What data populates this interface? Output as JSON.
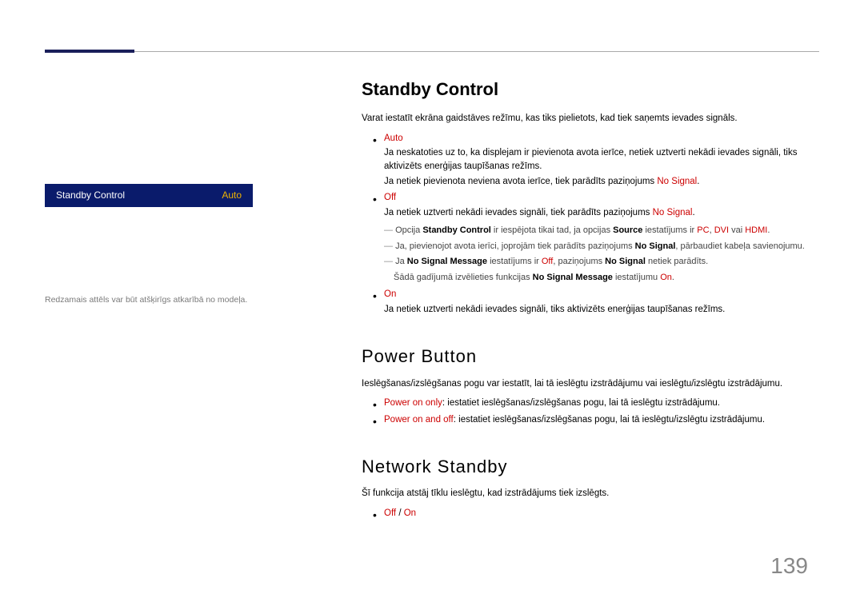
{
  "sidebar": {
    "menu_label": "Standby Control",
    "menu_value": "Auto",
    "note": "Redzamais attēls var būt atšķirīgs atkarībā no modeļa."
  },
  "section1": {
    "title": "Standby Control",
    "intro": "Varat iestatīt ekrāna gaidstāves režīmu, kas tiks pielietots, kad tiek saņemts ievades signāls.",
    "items": {
      "auto": {
        "title": "Auto",
        "l1": "Ja neskatoties uz to, ka displejam ir pievienota avota ierīce, netiek uztverti nekādi ievades signāli, tiks aktivizēts enerģijas taupīšanas režīms.",
        "l2_pre": "Ja netiek pievienota neviena avota ierīce, tiek parādīts paziņojums ",
        "l2_red": "No Signal",
        "l2_post": "."
      },
      "off": {
        "title": "Off",
        "l_pre": "Ja netiek uztverti nekādi ievades signāli, tiek parādīts paziņojums ",
        "l_red": "No Signal",
        "l_post": "."
      },
      "on": {
        "title": "On",
        "l": "Ja netiek uztverti nekādi ievades signāli, tiks aktivizēts enerģijas taupīšanas režīms."
      }
    },
    "notes": {
      "n1": {
        "pre": "Opcija ",
        "b1": "Standby Control",
        "mid1": " ir iespējota tikai tad, ja opcijas ",
        "b2": "Source",
        "mid2": " iestatījums ir ",
        "r1": "PC",
        "c1": ", ",
        "r2": "DVI",
        "c2": " vai ",
        "r3": "HDMI",
        "post": "."
      },
      "n2": {
        "pre": "Ja, pievienojot avota ierīci, joprojām tiek parādīts paziņojums ",
        "r": "No Signal",
        "post": ", pārbaudiet kabeļa savienojumu."
      },
      "n3": {
        "pre": "Ja ",
        "b1": "No Signal Message",
        "mid1": " iestatījums ir ",
        "r1": "Off",
        "mid2": ", paziņojums ",
        "b2": "No Signal",
        "post": " netiek parādīts."
      },
      "n3b": {
        "pre": "Šādā gadījumā izvēlieties funkcijas ",
        "b": "No Signal Message",
        "mid": " iestatījumu ",
        "r": "On",
        "post": "."
      }
    }
  },
  "section2": {
    "title": "Power Button",
    "intro": "Ieslēgšanas/izslēgšanas pogu var iestatīt, lai tā ieslēgtu izstrādājumu vai ieslēgtu/izslēgtu izstrādājumu.",
    "i1": {
      "r": "Power on only",
      "t": ": iestatiet ieslēgšanas/izslēgšanas pogu, lai tā ieslēgtu izstrādājumu."
    },
    "i2": {
      "r": "Power on and off",
      "t": ": iestatiet ieslēgšanas/izslēgšanas pogu, lai tā ieslēgtu/izslēgtu izstrādājumu."
    }
  },
  "section3": {
    "title": "Network Standby",
    "intro": "Šī funkcija atstāj tīklu ieslēgtu, kad izstrādājums tiek izslēgts.",
    "opt1": "Off",
    "sep": " / ",
    "opt2": "On"
  },
  "page_number": "139"
}
